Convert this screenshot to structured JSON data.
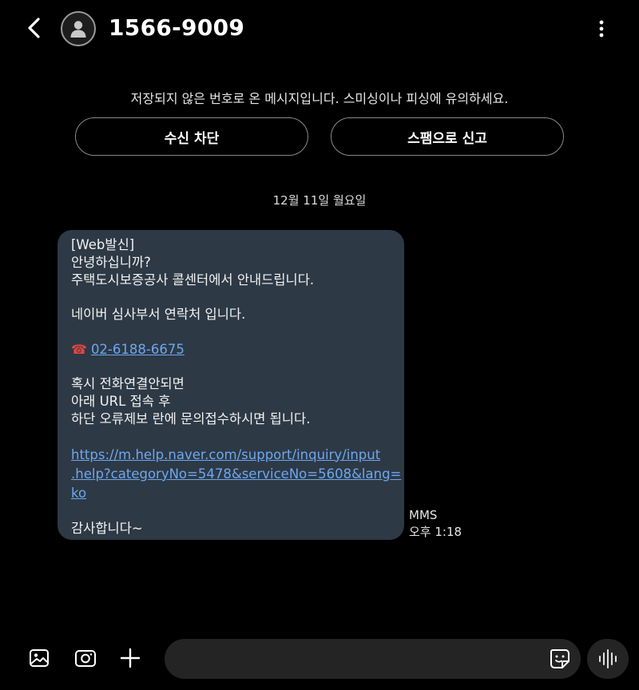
{
  "header": {
    "contact_name": "1566-9009",
    "icons": {
      "back": "back-arrow-icon",
      "avatar": "person-icon",
      "expand": "chevron-down-icon",
      "more": "more-vertical-icon"
    }
  },
  "warning": {
    "text": "저장되지 않은 번호로 온 메시지입니다. 스미싱이나 피싱에 유의하세요.",
    "block_label": "수신 차단",
    "spam_label": "스팸으로 신고"
  },
  "date_separator": "12월 11일 월요일",
  "message": {
    "lines_top": [
      "[Web발신]",
      "안녕하십니까?",
      "주택도시보증공사 콜센터에서 안내드립니다."
    ],
    "line_dept": "네이버 심사부서 연락처 입니다.",
    "phone_icon": "☎",
    "phone": "02-6188-6675",
    "lines_mid": [
      "혹시 전화연결안되면",
      "아래 URL 접속 후",
      "하단 오류제보 란에 문의접수하시면 됩니다."
    ],
    "url_lines": [
      "https://m.help.naver.com/support/inquiry/input",
      ".help?categoryNo=5478&serviceNo=5608&lang=",
      "ko"
    ],
    "closing": "감사합니다~",
    "type": "MMS",
    "time": "오후 1:18"
  },
  "composer": {
    "placeholder": "",
    "icons": {
      "gallery": "gallery-icon",
      "camera": "camera-icon",
      "add": "plus-icon",
      "emoji": "sticker-icon",
      "voice": "voice-wave-icon"
    }
  },
  "colors": {
    "background": "#000000",
    "bubble": "#2d3945",
    "link": "#6da7f0",
    "phone_icon": "#e0463f"
  }
}
